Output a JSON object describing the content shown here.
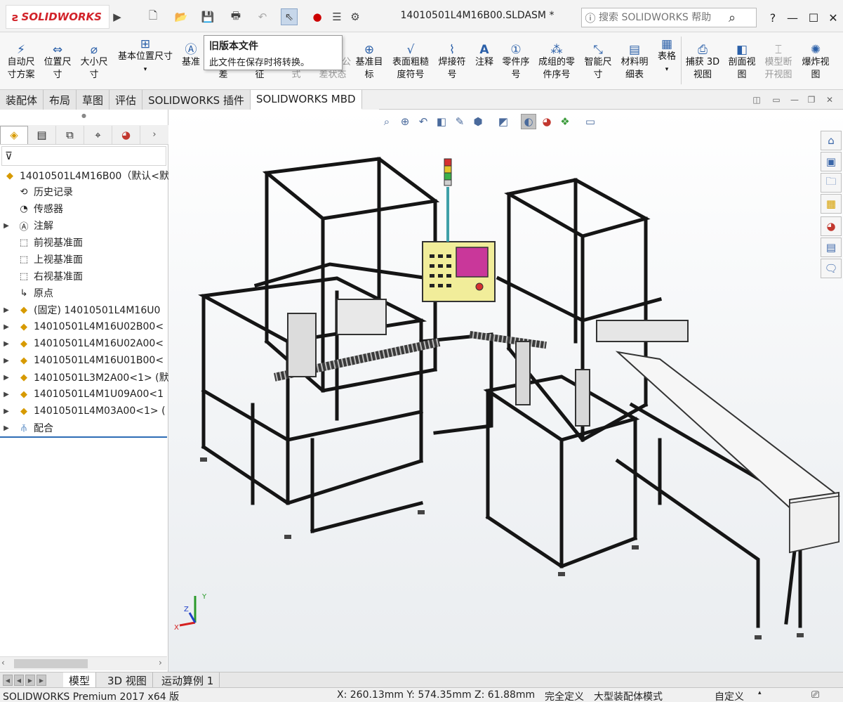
{
  "app": {
    "logo": "SOLIDWORKS",
    "doc_title": "14010501L4M16B00.SLDASM *"
  },
  "search": {
    "placeholder": "搜索 SOLIDWORKS 帮助"
  },
  "titlebar_icons": [
    "expand-arrow-icon",
    "new-icon",
    "open-icon",
    "save-icon",
    "print-icon",
    "undo-icon",
    "select-icon",
    "rebuild-traffic-icon",
    "file-properties-icon",
    "options-gear-icon"
  ],
  "window_controls": {
    "help": "?",
    "minimize": "—",
    "maximize": "☐",
    "close": "✕"
  },
  "ribbon": {
    "buttons": [
      {
        "name": "auto-dimension-scheme",
        "line1": "自动尺",
        "line2": "寸方案",
        "icon": "dimxpert-icon"
      },
      {
        "name": "location-dimension",
        "line1": "位置尺",
        "line2": "寸",
        "icon": "location-dim-icon"
      },
      {
        "name": "size-dimension",
        "line1": "大小尺",
        "line2": "寸",
        "icon": "size-dim-icon"
      },
      {
        "name": "basic-location-dimension",
        "line1": "基本位置尺寸",
        "line2": "",
        "icon": "basic-dim-icon"
      },
      {
        "name": "datum",
        "line1": "基准",
        "line2": "",
        "icon": "datum-icon"
      },
      {
        "name": "tolerance",
        "line1": "",
        "line2": "差",
        "icon": ""
      },
      {
        "name": "feature",
        "line1": "",
        "line2": "征",
        "icon": ""
      },
      {
        "name": "pattern",
        "line1": "",
        "line2": "式",
        "icon": ""
      },
      {
        "name": "tolerance-status",
        "line1": "公",
        "line2": "差状态",
        "icon": ""
      },
      {
        "name": "datum-target",
        "line1": "基准目",
        "line2": "标",
        "icon": "datum-target-icon"
      },
      {
        "name": "surface-finish",
        "line1": "表面粗糙",
        "line2": "度符号",
        "icon": "surface-finish-icon"
      },
      {
        "name": "weld-symbol",
        "line1": "焊接符",
        "line2": "号",
        "icon": "weld-icon"
      },
      {
        "name": "note",
        "line1": "注释",
        "line2": "",
        "icon": "note-A-icon"
      },
      {
        "name": "balloon",
        "line1": "零件序",
        "line2": "号",
        "icon": "balloon-icon"
      },
      {
        "name": "stacked-balloon",
        "line1": "成组的零",
        "line2": "件序号",
        "icon": "stacked-balloon-icon"
      },
      {
        "name": "smart-dimension",
        "line1": "智能尺",
        "line2": "寸",
        "icon": "smart-dim-icon"
      },
      {
        "name": "bom",
        "line1": "材料明",
        "line2": "细表",
        "icon": "bom-icon"
      },
      {
        "name": "table",
        "line1": "表格",
        "line2": "",
        "icon": "table-icon"
      },
      {
        "name": "capture-3d-view",
        "line1": "捕获 3D",
        "line2": "视图",
        "icon": "capture-3d-icon"
      },
      {
        "name": "section-view",
        "line1": "剖面视",
        "line2": "图",
        "icon": "section-view-icon"
      },
      {
        "name": "model-break-view",
        "line1": "模型断",
        "line2": "开视图",
        "icon": "break-view-icon"
      },
      {
        "name": "exploded-view",
        "line1": "爆炸视",
        "line2": "图",
        "icon": "explode-icon"
      }
    ]
  },
  "tooltip": {
    "title": "旧版本文件",
    "body": "此文件在保存时将转换。"
  },
  "command_tabs": [
    "装配体",
    "布局",
    "草图",
    "评估",
    "SOLIDWORKS 插件",
    "SOLIDWORKS MBD"
  ],
  "command_tabs_active": 5,
  "panel_tabs": [
    "feature-manager-icon",
    "property-manager-icon",
    "configuration-manager-icon",
    "dimxpert-manager-icon",
    "display-manager-icon"
  ],
  "tree": {
    "root": "14010501L4M16B00（默认<默",
    "items": [
      {
        "label": "历史记录",
        "icon": "history-icon",
        "expand": false
      },
      {
        "label": "传感器",
        "icon": "sensor-icon",
        "expand": false
      },
      {
        "label": "注解",
        "icon": "annotation-icon",
        "expand": true
      },
      {
        "label": "前视基准面",
        "icon": "plane-icon",
        "expand": false
      },
      {
        "label": "上视基准面",
        "icon": "plane-icon",
        "expand": false
      },
      {
        "label": "右视基准面",
        "icon": "plane-icon",
        "expand": false
      },
      {
        "label": "原点",
        "icon": "origin-icon",
        "expand": false
      },
      {
        "label": "(固定) 14010501L4M16U0",
        "icon": "subassembly-icon",
        "expand": true
      },
      {
        "label": "14010501L4M16U02B00<",
        "icon": "subassembly-icon",
        "expand": true
      },
      {
        "label": "14010501L4M16U02A00<",
        "icon": "subassembly-icon",
        "expand": true
      },
      {
        "label": "14010501L4M16U01B00<",
        "icon": "subassembly-icon",
        "expand": true
      },
      {
        "label": "14010501L3M2A00<1> (默",
        "icon": "subassembly-icon",
        "expand": true
      },
      {
        "label": "14010501L4M1U09A00<1",
        "icon": "subassembly-icon",
        "expand": true
      },
      {
        "label": "14010501L4M03A00<1> (",
        "icon": "subassembly-icon",
        "expand": true
      },
      {
        "label": "配合",
        "icon": "mates-icon",
        "expand": true
      }
    ]
  },
  "heads_up_icons": [
    "zoom-to-fit-icon",
    "zoom-area-icon",
    "previous-view-icon",
    "section-view-icon",
    "dynamic-annotation-icon",
    "view-orientation-icon",
    "display-style-icon",
    "hide-show-icon",
    "edit-appearance-icon",
    "apply-scene-icon",
    "view-settings-icon"
  ],
  "task_pane_icons": [
    "home-icon",
    "design-library-icon",
    "file-explorer-icon",
    "view-palette-icon",
    "appearances-icon",
    "custom-properties-icon",
    "forum-icon"
  ],
  "bottom_tabs": [
    "模型",
    "3D 视图",
    "运动算例 1"
  ],
  "bottom_tabs_active": 0,
  "status": {
    "product": "SOLIDWORKS Premium 2017 x64 版",
    "coords": "X: 260.13mm Y: 574.35mm Z: 61.88mm",
    "state": "完全定义",
    "mode": "大型装配体模式",
    "custom": "自定义"
  },
  "triad": {
    "x": "X",
    "y": "Y",
    "z": "Z"
  },
  "colors": {
    "accent": "#2d6db5",
    "brand": "#d2232a",
    "frame": "#222222"
  }
}
